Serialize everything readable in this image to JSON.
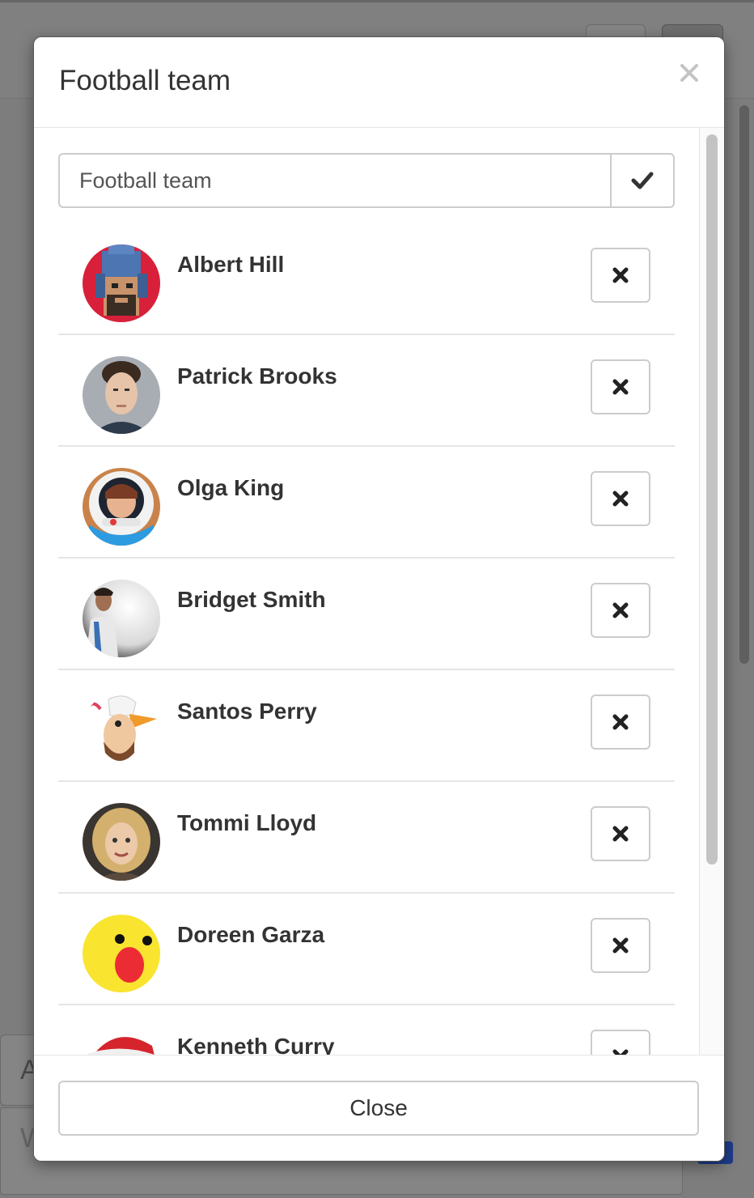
{
  "background": {
    "bottom_input_initial": "A",
    "bottom_textarea_initial": "W"
  },
  "modal": {
    "title": "Football team",
    "close_icon": "times-icon",
    "name_input": {
      "value": "Football team"
    },
    "confirm_icon": "checkmark-icon",
    "members": [
      {
        "name": "Albert Hill",
        "avatar": "pixel-art-hooded-man"
      },
      {
        "name": "Patrick Brooks",
        "avatar": "photo-young-man"
      },
      {
        "name": "Olga King",
        "avatar": "astronaut-helmet"
      },
      {
        "name": "Bridget Smith",
        "avatar": "photo-woman-sphere"
      },
      {
        "name": "Santos Perry",
        "avatar": "cartoon-duck-man"
      },
      {
        "name": "Tommi Lloyd",
        "avatar": "photo-curly-haired-woman"
      },
      {
        "name": "Doreen Garza",
        "avatar": "surprised-emoji"
      },
      {
        "name": "Kenneth Curry",
        "avatar": "santa-hat"
      }
    ],
    "remove_icon": "times-icon",
    "close_button": "Close"
  },
  "colors": {
    "overlay": "#7d7d7d",
    "text": "#333333",
    "border": "#cccccc",
    "divider": "#e5e5e5"
  }
}
